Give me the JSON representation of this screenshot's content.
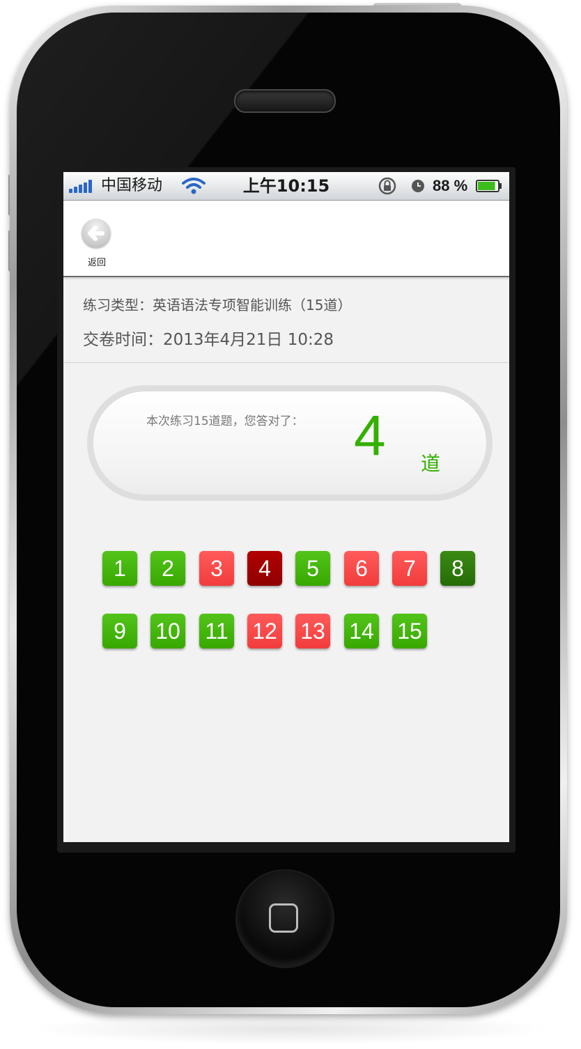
{
  "status_bar": {
    "carrier": "中国移动",
    "time": "上午10:15",
    "battery": "88 %",
    "signal_icon": "signal-bars-icon",
    "wifi_icon": "wifi-icon",
    "rotation_lock_icon": "rotation-lock-icon",
    "alarm_icon": "alarm-icon",
    "battery_icon": "battery-icon",
    "battery_level": 0.88
  },
  "nav": {
    "back_label": "返回"
  },
  "info": {
    "practice_type": "练习类型：英语语法专项智能训练（15道）",
    "submit_time": "交卷时间：2013年4月21日 10:28"
  },
  "score": {
    "prompt": "本次练习15道题，您答对了：",
    "correct_count": "4",
    "unit": "道"
  },
  "questions": [
    {
      "number": "1",
      "state": "correct"
    },
    {
      "number": "2",
      "state": "correct"
    },
    {
      "number": "3",
      "state": "wrong"
    },
    {
      "number": "4",
      "state": "selected-wrong"
    },
    {
      "number": "5",
      "state": "correct"
    },
    {
      "number": "6",
      "state": "wrong"
    },
    {
      "number": "7",
      "state": "wrong"
    },
    {
      "number": "8",
      "state": "selected-correct"
    },
    {
      "number": "9",
      "state": "correct"
    },
    {
      "number": "10",
      "state": "correct"
    },
    {
      "number": "11",
      "state": "correct"
    },
    {
      "number": "12",
      "state": "wrong"
    },
    {
      "number": "13",
      "state": "wrong"
    },
    {
      "number": "14",
      "state": "correct"
    },
    {
      "number": "15",
      "state": "correct"
    }
  ],
  "colors": {
    "correct": "#44b80c",
    "wrong": "#f64444",
    "selected_wrong": "#a30000",
    "selected_correct": "#2e7a0c",
    "score_accent": "#33b000"
  }
}
